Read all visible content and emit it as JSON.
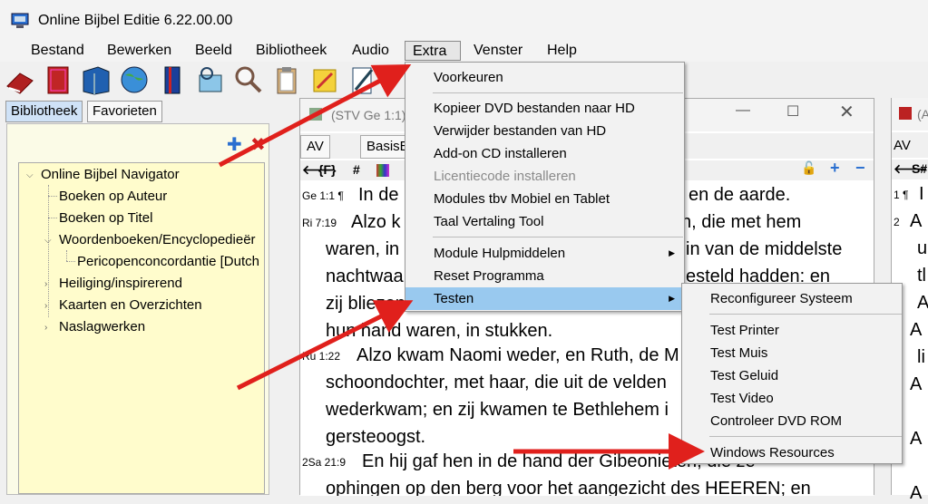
{
  "window": {
    "title": "Online Bijbel Editie 6.22.00.00"
  },
  "menubar": [
    "Bestand",
    "Bewerken",
    "Beeld",
    "Bibliotheek",
    "Audio",
    "Extra",
    "Venster",
    "Help"
  ],
  "left_panel": {
    "tabs": [
      "Bibliotheek",
      "Favorieten"
    ],
    "tree": [
      "Online Bijbel Navigator",
      "Boeken op Auteur",
      "Boeken op Titel",
      "Woordenboeken/Encyclopedieër",
      "Pericopenconcordantie [Dutch",
      "Heiliging/inspirerend",
      "Kaarten en Overzichten",
      "Naslagwerken"
    ]
  },
  "mid_window": {
    "title": "(STV Ge 1:1)",
    "tabs": [
      "AV",
      "BasisB"
    ],
    "tools": {
      "f_label": "{F}",
      "hash": "#"
    },
    "verses": [
      {
        "ref": "Ge 1:1 ¶",
        "lines": [
          "In de",
          "en de aarde."
        ]
      },
      {
        "ref": "Ri 7:19",
        "lines": [
          "Alzo k",
          "n, die met hem",
          "waren, in",
          "in van de middelste",
          "nachtwaa",
          "esteld hadden: en",
          "zij bliezen",
          "hun hand waren, in stukken."
        ]
      },
      {
        "ref": "Ru 1:22",
        "lines": [
          "Alzo kwam Naomi weder, en Ruth, de M",
          "schoondochter, met haar, die uit de velden",
          "wederkwam; en zij kwamen te Bethlehem i",
          "gersteoogst."
        ]
      },
      {
        "ref": "2Sa 21:9",
        "lines": [
          "En hij gaf hen in de hand der Gibeonieten, die ze",
          "ophingen op den berg voor het aangezicht des HEEREN; en"
        ]
      }
    ]
  },
  "right_window": {
    "title": "(A",
    "tab": "AV",
    "tool": "S#",
    "numbers": [
      "1 ¶",
      "2"
    ],
    "text": [
      "I",
      "A",
      "u",
      "tl",
      "A",
      "A",
      "li",
      "A",
      "A",
      "A"
    ]
  },
  "extra_menu": {
    "items": [
      {
        "label": "Voorkeuren",
        "enabled": true
      },
      {
        "label": "Kopieer DVD bestanden naar HD",
        "enabled": true
      },
      {
        "label": "Verwijder bestanden van HD",
        "enabled": true
      },
      {
        "label": "Add-on CD installeren",
        "enabled": true
      },
      {
        "label": "Licentiecode installeren",
        "enabled": false
      },
      {
        "label": "Modules tbv Mobiel en Tablet",
        "enabled": true
      },
      {
        "label": "Taal Vertaling Tool",
        "enabled": true
      },
      {
        "label": "Module Hulpmiddelen",
        "enabled": true,
        "submenu": true
      },
      {
        "label": "Reset Programma",
        "enabled": true
      },
      {
        "label": "Testen",
        "enabled": true,
        "submenu": true,
        "highlighted": true
      }
    ]
  },
  "testen_submenu": {
    "items": [
      "Reconfigureer Systeem",
      "Test Printer",
      "Test Muis",
      "Test Geluid",
      "Test Video",
      "Controleer DVD ROM",
      "Windows Resources"
    ]
  },
  "colors": {
    "highlight": "#99c9ef",
    "arrow": "#e0201c",
    "tree_bg": "#fffccc"
  }
}
